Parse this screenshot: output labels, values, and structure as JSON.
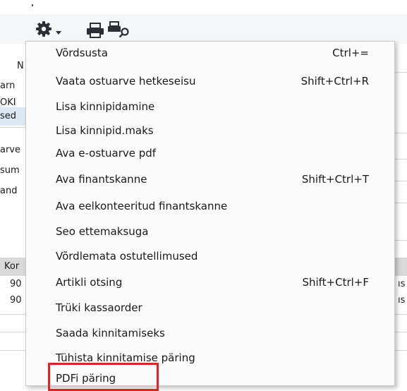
{
  "toolbar": {
    "settings_icon": "gear-icon",
    "dropdown_icon": "chevron-down-icon",
    "print_icon": "printer-icon",
    "print_preview_icon": "print-preview-icon"
  },
  "background_fragments": [
    {
      "text": "N"
    },
    {
      "text": "arn"
    },
    {
      "text": "OKI"
    },
    {
      "text": "sed"
    },
    {
      "text": "arve"
    },
    {
      "text": "sum"
    },
    {
      "text": "and"
    },
    {
      "text": "Kor"
    },
    {
      "text": "90"
    },
    {
      "text": "90"
    },
    {
      "text": "ıs"
    },
    {
      "text": "ıs"
    }
  ],
  "menu": {
    "items": [
      {
        "label": "Võrdsusta",
        "shortcut": "Ctrl+="
      },
      {
        "label": "Vaata ostuarve hetkeseisu",
        "shortcut": "Shift+Ctrl+R"
      },
      {
        "label": "Lisa kinnipidamine",
        "shortcut": ""
      },
      {
        "label": "Lisa kinnipid.maks",
        "shortcut": ""
      },
      {
        "label": "Ava e-ostuarve pdf",
        "shortcut": ""
      },
      {
        "label": "Ava finantskanne",
        "shortcut": "Shift+Ctrl+T"
      },
      {
        "label": "Ava eelkonteeritud finantskanne",
        "shortcut": ""
      },
      {
        "label": "Seo ettemaksuga",
        "shortcut": ""
      },
      {
        "label": "Võrdlemata ostutellimused",
        "shortcut": ""
      },
      {
        "label": "Artikli otsing",
        "shortcut": "Shift+Ctrl+F"
      },
      {
        "label": "Trüki kassaorder",
        "shortcut": ""
      },
      {
        "label": "Saada kinnitamiseks",
        "shortcut": ""
      },
      {
        "label": "Tühista kinnitamise päring",
        "shortcut": ""
      },
      {
        "label": "PDFi päring",
        "shortcut": ""
      }
    ],
    "highlighted_item": "PDFi päring",
    "highlight_color": "#e02424"
  }
}
